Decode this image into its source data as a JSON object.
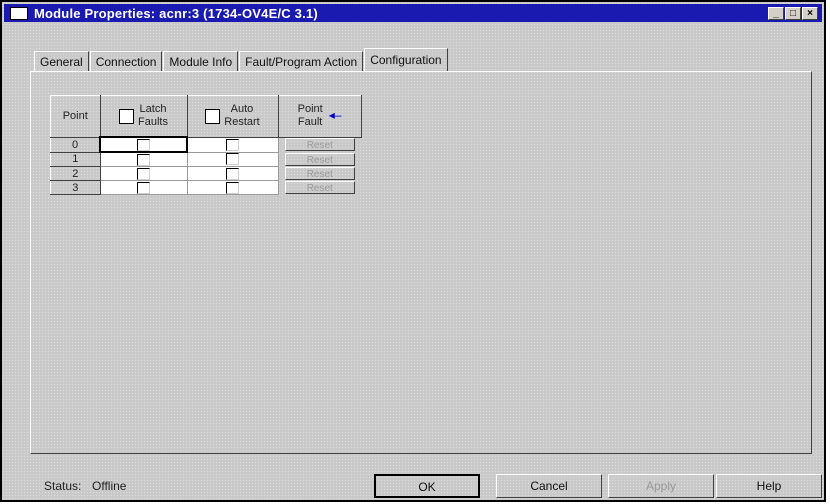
{
  "window": {
    "title": "Module Properties: acnr:3 (1734-OV4E/C 3.1)",
    "title_buttons": [
      "_",
      "□",
      "×"
    ]
  },
  "tabs": [
    {
      "label": "General"
    },
    {
      "label": "Connection"
    },
    {
      "label": "Module Info"
    },
    {
      "label": "Fault/Program Action"
    },
    {
      "label": "Configuration",
      "active": true
    }
  ],
  "table": {
    "headers": {
      "point": "Point",
      "latch_faults_1": "Latch",
      "latch_faults_2": "Faults",
      "auto_restart_1": "Auto",
      "auto_restart_2": "Restart",
      "point_fault_1": "Point",
      "point_fault_2": "Fault"
    },
    "rows": [
      {
        "point": "0",
        "latch": false,
        "auto": false,
        "reset": "Reset"
      },
      {
        "point": "1",
        "latch": false,
        "auto": false,
        "reset": "Reset"
      },
      {
        "point": "2",
        "latch": false,
        "auto": false,
        "reset": "Reset"
      },
      {
        "point": "3",
        "latch": false,
        "auto": false,
        "reset": "Reset"
      }
    ]
  },
  "status": {
    "label": "Status:",
    "value": "Offline"
  },
  "buttons": {
    "ok": "OK",
    "cancel": "Cancel",
    "apply": "Apply",
    "help": "Help"
  },
  "colors": {
    "titlebar": "#1a1ab0",
    "dialog_bg": "#c9c9c9",
    "arrow": "#0000cc"
  }
}
